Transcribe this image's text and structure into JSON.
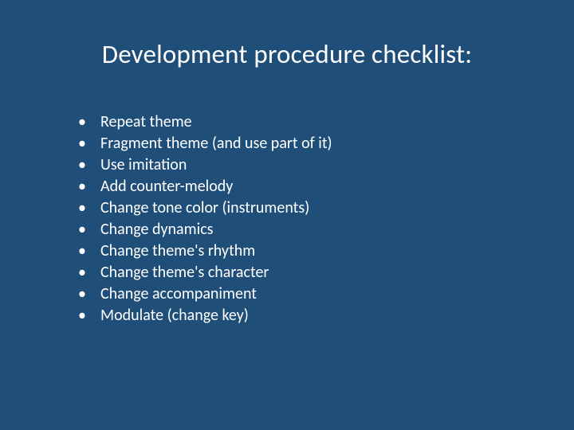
{
  "title": "Development procedure checklist:",
  "items": [
    "Repeat theme",
    "Fragment theme (and use part of it)",
    "Use imitation",
    "Add counter-melody",
    "Change tone color (instruments)",
    "Change dynamics",
    "Change theme's rhythm",
    "Change theme's character",
    "Change accompaniment",
    "Modulate (change key)"
  ]
}
